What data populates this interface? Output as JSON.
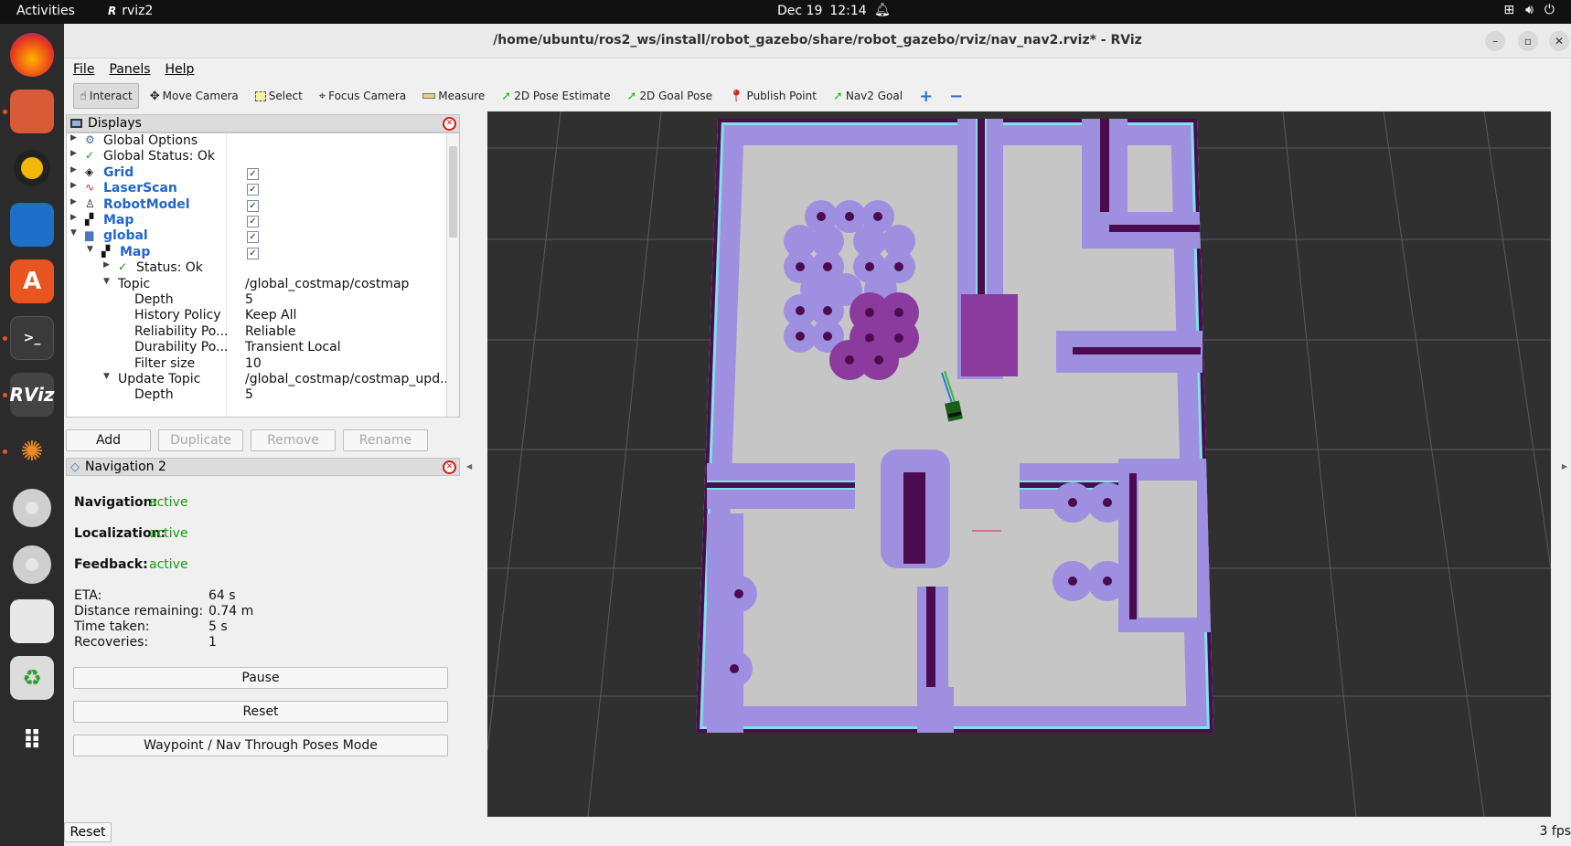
{
  "topbar": {
    "activities": "Activities",
    "app_name": "rviz2",
    "app_glyph": "R",
    "date": "Dec 19",
    "time": "12:14"
  },
  "window": {
    "title": "/home/ubuntu/ros2_ws/install/robot_gazebo/share/robot_gazebo/rviz/nav_nav2.rviz* - RViz"
  },
  "menu": {
    "file": "File",
    "panels": "Panels",
    "help": "Help"
  },
  "toolbar": {
    "interact": "Interact",
    "move_camera": "Move Camera",
    "select": "Select",
    "focus_camera": "Focus Camera",
    "measure": "Measure",
    "pose_estimate": "2D Pose Estimate",
    "goal_pose": "2D Goal Pose",
    "publish_point": "Publish Point",
    "nav2_goal": "Nav2 Goal",
    "plus": "+",
    "minus": "−"
  },
  "displays": {
    "title": "Displays",
    "rows": [
      {
        "name": "Global Options",
        "value": ""
      },
      {
        "name": "Global Status: Ok",
        "value": ""
      },
      {
        "name": "Grid",
        "value": ""
      },
      {
        "name": "LaserScan",
        "value": ""
      },
      {
        "name": "RobotModel",
        "value": ""
      },
      {
        "name": "Map",
        "value": ""
      },
      {
        "name": "global",
        "value": ""
      },
      {
        "name": "Map",
        "value": ""
      },
      {
        "name": "Status: Ok",
        "value": ""
      },
      {
        "name": "Topic",
        "value": "/global_costmap/costmap"
      },
      {
        "name": "Depth",
        "value": "5"
      },
      {
        "name": "History Policy",
        "value": "Keep All"
      },
      {
        "name": "Reliability Po...",
        "value": "Reliable"
      },
      {
        "name": "Durability Po...",
        "value": "Transient Local"
      },
      {
        "name": "Filter size",
        "value": "10"
      },
      {
        "name": "Update Topic",
        "value": "/global_costmap/costmap_upd..."
      },
      {
        "name": "Depth",
        "value": "5"
      }
    ],
    "buttons": {
      "add": "Add",
      "duplicate": "Duplicate",
      "remove": "Remove",
      "rename": "Rename"
    }
  },
  "nav2": {
    "title": "Navigation 2",
    "navigation_label": "Navigation:",
    "navigation_value": "active",
    "localization_label": "Localization:",
    "localization_value": "active",
    "feedback_label": "Feedback:",
    "feedback_value": "active",
    "eta_label": "ETA:",
    "eta_value": "64 s",
    "distance_label": "Distance remaining:",
    "distance_value": "0.74 m",
    "time_label": "Time taken:",
    "time_value": "5 s",
    "recoveries_label": "Recoveries:",
    "recoveries_value": "1",
    "pause": "Pause",
    "reset": "Reset",
    "waypoint_mode": "Waypoint / Nav Through Poses Mode"
  },
  "statusbar": {
    "reset": "Reset",
    "fps": "3 fps"
  },
  "colors": {
    "active_green": "#159a15",
    "link_blue": "#2266cc",
    "inflation": "#9f8fe0",
    "lethal": "#4a0c4e",
    "inscribed": "#7fe3e8",
    "free": "#c8c8c8"
  }
}
